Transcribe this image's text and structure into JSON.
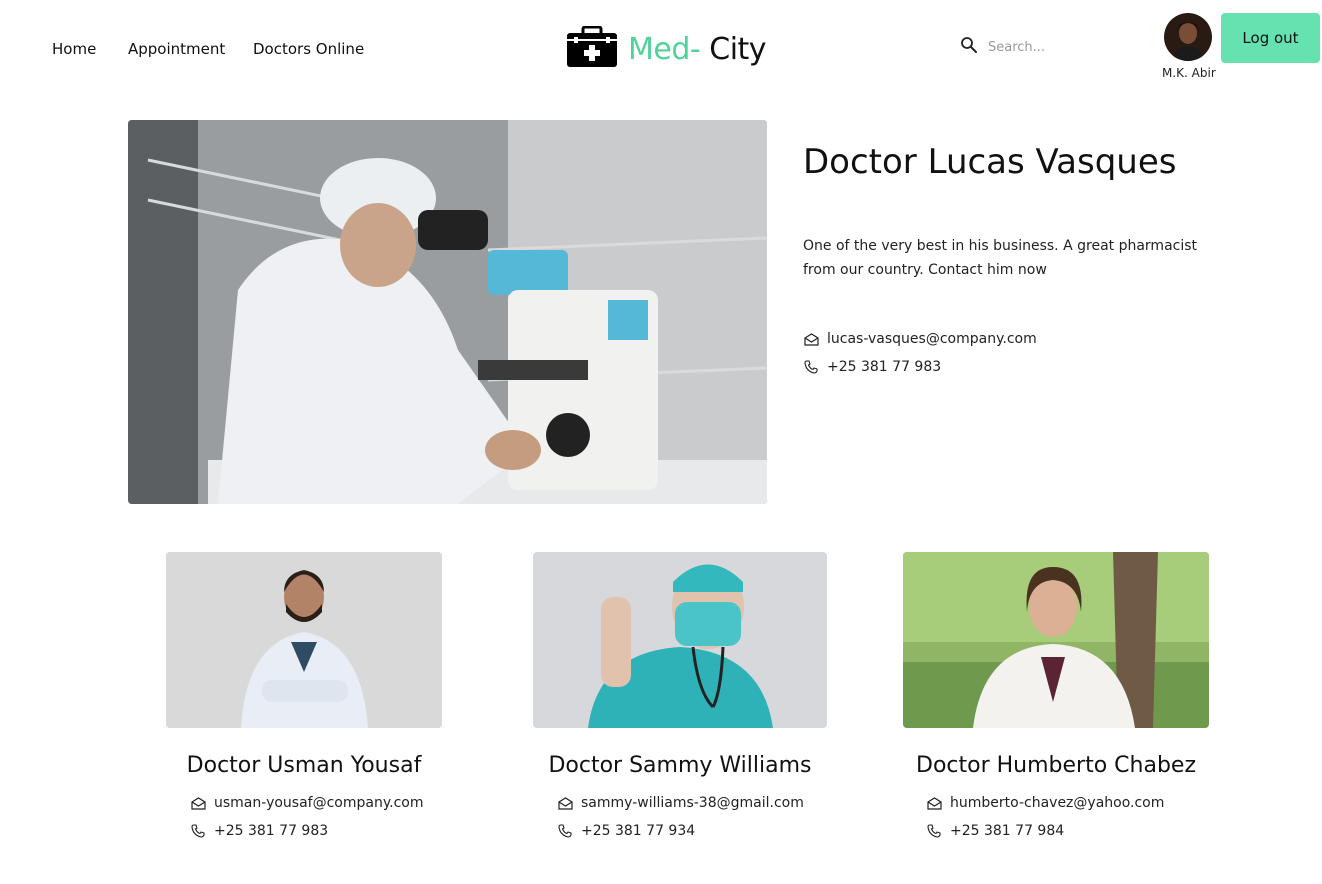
{
  "nav": {
    "items": [
      {
        "label": "Home"
      },
      {
        "label": "Appointment"
      },
      {
        "label": "Doctors Online"
      }
    ]
  },
  "logo": {
    "accent": "Med-",
    "rest": " City",
    "icon": "medical-kit-icon",
    "accent_color": "#4fd39b"
  },
  "search": {
    "placeholder": "Search...",
    "icon": "search-icon"
  },
  "user": {
    "name": "M.K. Abir",
    "logout_label": "Log out",
    "logout_color": "#66e2b0"
  },
  "featured": {
    "name": "Doctor Lucas Vasques",
    "description": "One of the very best in his business. A great pharmacist from our country. Contact him now",
    "email": "lucas-vasques@company.com",
    "phone": "+25 381 77 983"
  },
  "doctors": [
    {
      "name": "Doctor Usman Yousaf",
      "email": "usman-yousaf@company.com",
      "phone": "+25 381 77 983"
    },
    {
      "name": "Doctor Sammy Williams",
      "email": "sammy-williams-38@gmail.com",
      "phone": "+25 381 77 934"
    },
    {
      "name": "Doctor Humberto Chabez",
      "email": "humberto-chavez@yahoo.com",
      "phone": "+25 381 77 984"
    }
  ]
}
